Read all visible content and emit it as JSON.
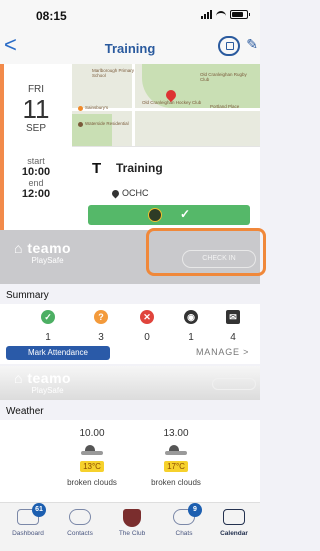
{
  "status": {
    "time": "08:15"
  },
  "nav": {
    "back_glyph": "<",
    "title": "Training",
    "edit_glyph": "✎"
  },
  "event": {
    "day_of_week": "FRI",
    "day": "11",
    "month": "SEP",
    "start_label": "start",
    "start_time": "10:00",
    "end_label": "end",
    "end_time": "12:00",
    "type_letter": "T",
    "title": "Training",
    "location": "OCHC",
    "accent_color": "#f28a4a",
    "attend_color": "#55b869",
    "map_labels": [
      "Marlborough Primary School",
      "Old Cranleighan Rugby Club",
      "Old Cranleighan Hockey Club",
      "Sainsbury's",
      "Portland Place",
      "Waterside Residential"
    ]
  },
  "banner": {
    "brand_name": "teamo",
    "brand_sub": "PlaySafe",
    "button_label": "CHECK IN"
  },
  "summary": {
    "label": "Summary",
    "stats": [
      {
        "icon": "check-icon",
        "value": "1",
        "color": "#4caf63"
      },
      {
        "icon": "question-icon",
        "value": "3",
        "color": "#f39a3b"
      },
      {
        "icon": "cross-icon",
        "value": "0",
        "color": "#e0443c"
      },
      {
        "icon": "eye-icon",
        "value": "1",
        "color": "#333333"
      },
      {
        "icon": "envelope-icon",
        "value": "4",
        "color": "#333333"
      }
    ],
    "mark_attendance": "Mark Attendance",
    "manage": "MANAGE"
  },
  "weather": {
    "label": "Weather",
    "forecasts": [
      {
        "time": "10.00",
        "temp": "13°C",
        "condition": "broken clouds"
      },
      {
        "time": "13.00",
        "temp": "17°C",
        "condition": "broken clouds"
      }
    ]
  },
  "tabs": [
    {
      "label": "Dashboard",
      "badge": "61"
    },
    {
      "label": "Contacts"
    },
    {
      "label": "The Club"
    },
    {
      "label": "Chats",
      "badge": "9"
    },
    {
      "label": "Calendar"
    }
  ],
  "colors": {
    "brand_blue": "#2a5aa8",
    "nav_blue": "#2a5a9e",
    "highlight_orange": "#f0883a"
  }
}
